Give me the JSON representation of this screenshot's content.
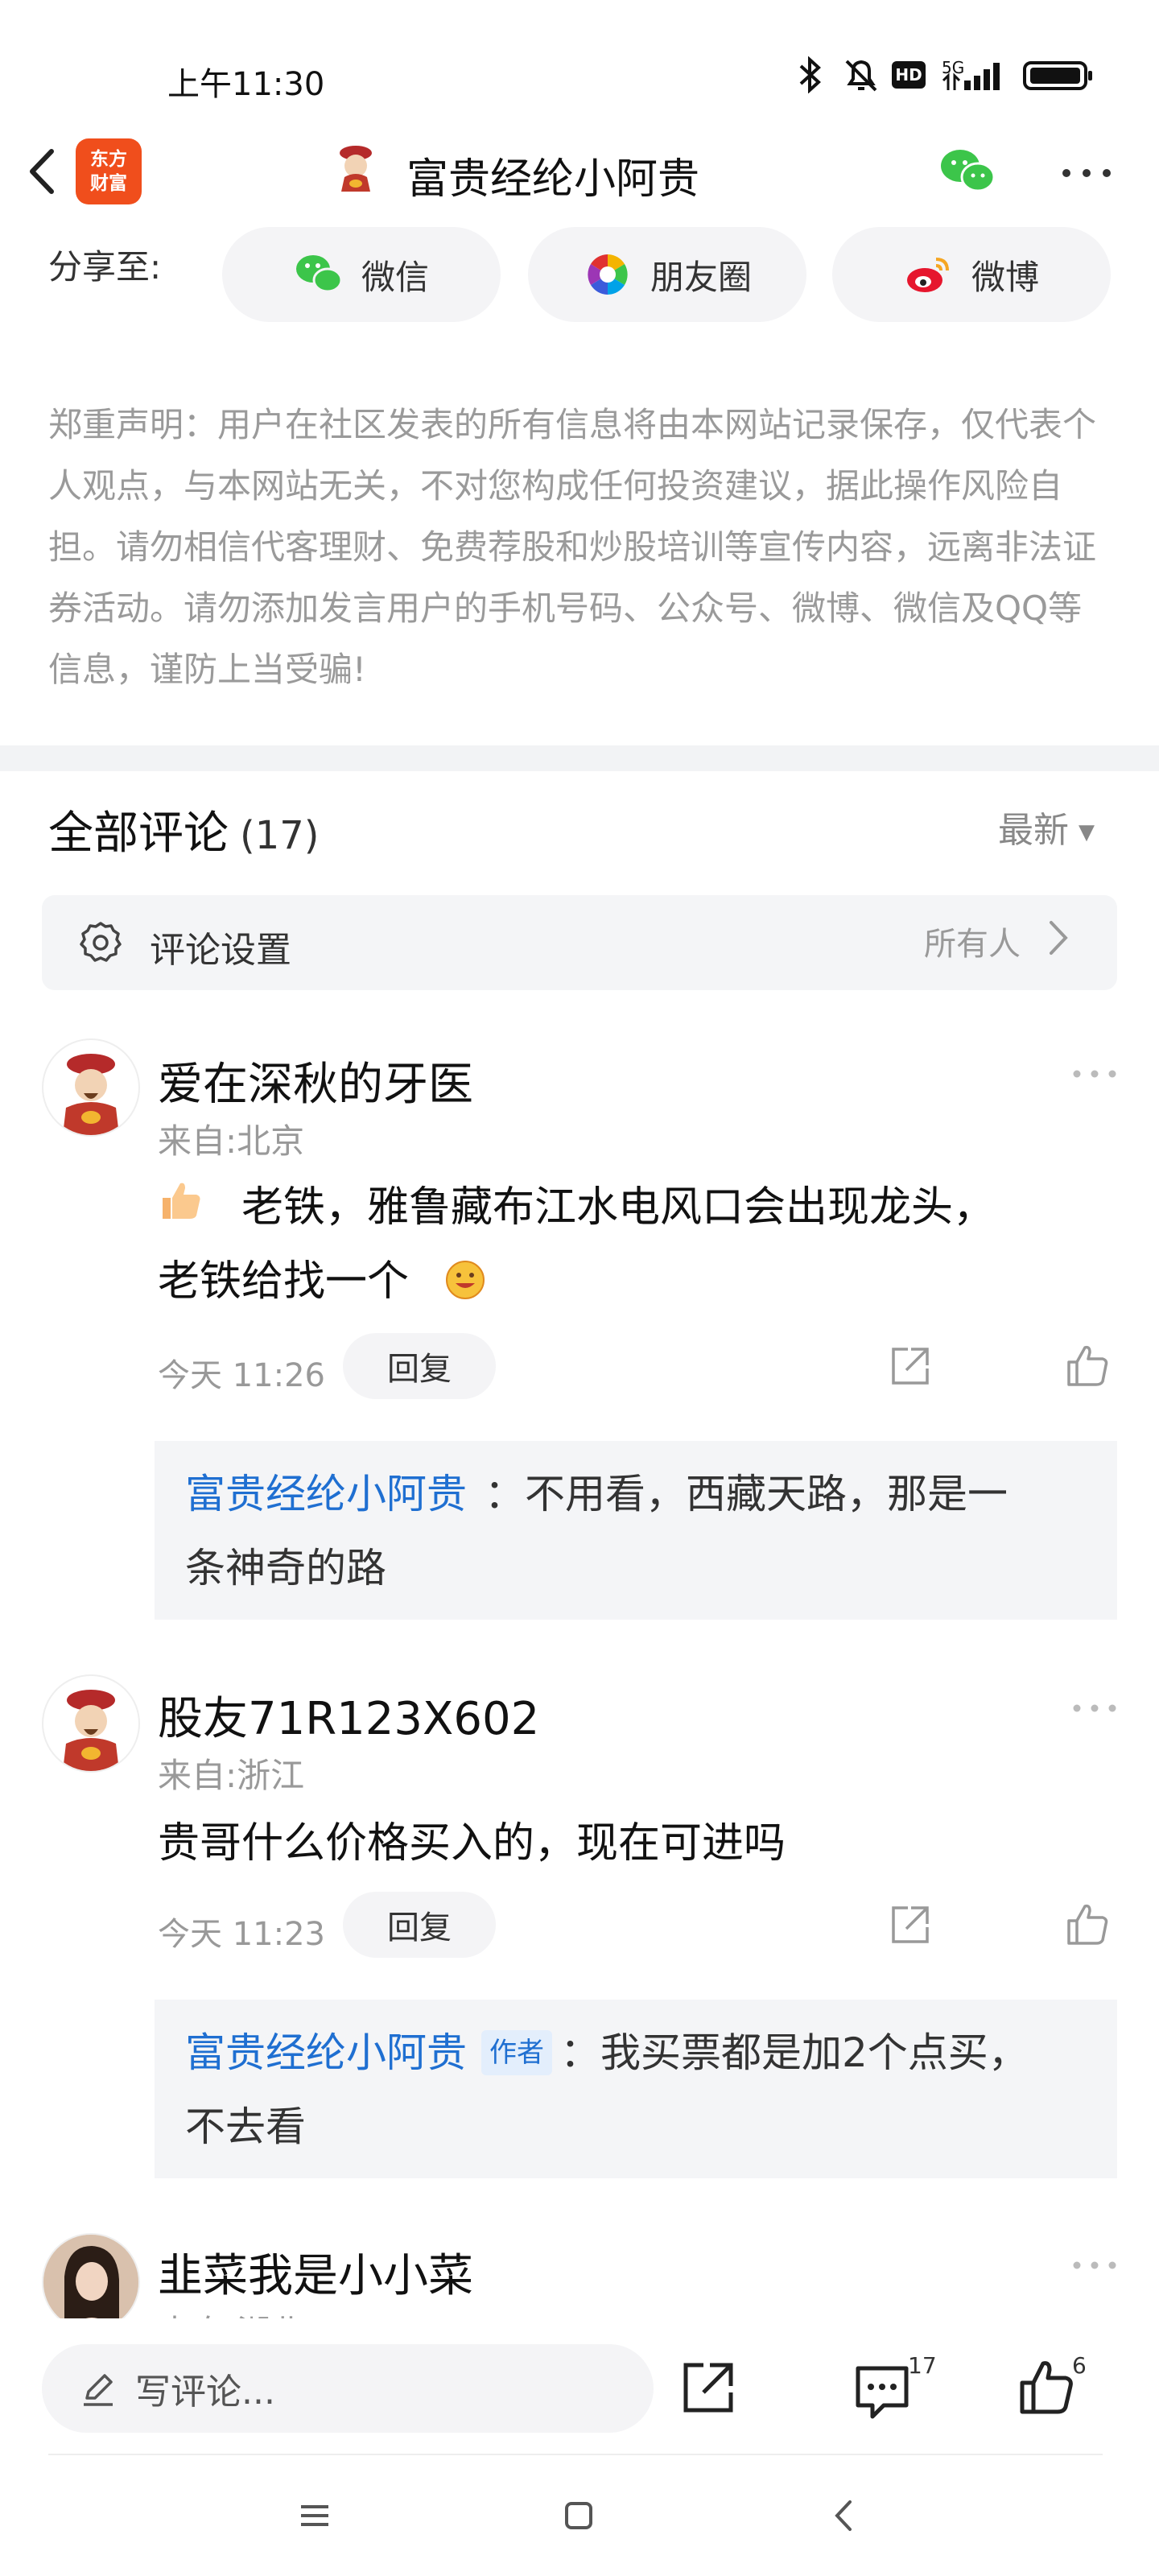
{
  "status_bar": {
    "time": "上午11:30",
    "network": "5G",
    "hd_badge": "HD"
  },
  "header": {
    "app_logo_line1": "东方",
    "app_logo_line2": "财富",
    "title": "富贵经纶小阿贵"
  },
  "share": {
    "label": "分享至:",
    "options": [
      "微信",
      "朋友圈",
      "微博"
    ]
  },
  "disclaimer": "郑重声明：用户在社区发表的所有信息将由本网站记录保存，仅代表个人观点，与本网站无关，不对您构成任何投资建议，据此操作风险自担。请勿相信代客理财、免费荐股和炒股培训等宣传内容，远离非法证券活动。请勿添加发言用户的手机号码、公众号、微博、微信及QQ等信息，谨防上当受骗!",
  "comments_section": {
    "title": "全部评论",
    "count": "(17)",
    "sort": "最新",
    "settings_label": "评论设置",
    "settings_value": "所有人"
  },
  "comments": [
    {
      "name": "爱在深秋的牙医",
      "location": "来自:北京",
      "text_line1": "老铁，雅鲁藏布江水电风口会出现龙头，",
      "text_line2": "老铁给找一个",
      "time": "今天 11:26",
      "reply_label": "回复",
      "reply_author": "富贵经纶小阿贵",
      "reply_line1": "：不用看，西藏天路，那是一",
      "reply_line2": "条神奇的路"
    },
    {
      "name": "股友71R123X602",
      "location": "来自:浙江",
      "text_line1": "贵哥什么价格买入的，现在可进吗",
      "time": "今天 11:23",
      "reply_label": "回复",
      "reply_author": "富贵经纶小阿贵",
      "reply_tag": "作者",
      "reply_line1": "：我买票都是加2个点买，",
      "reply_line2": "不去看"
    },
    {
      "name": "韭菜我是小小菜",
      "location": "来自:湖北"
    }
  ],
  "bottom_bar": {
    "input_placeholder": "写评论...",
    "comment_count": "17",
    "like_count": "6"
  },
  "colors": {
    "brand_orange": "#f04e1c",
    "link_blue": "#1f6fd1"
  }
}
